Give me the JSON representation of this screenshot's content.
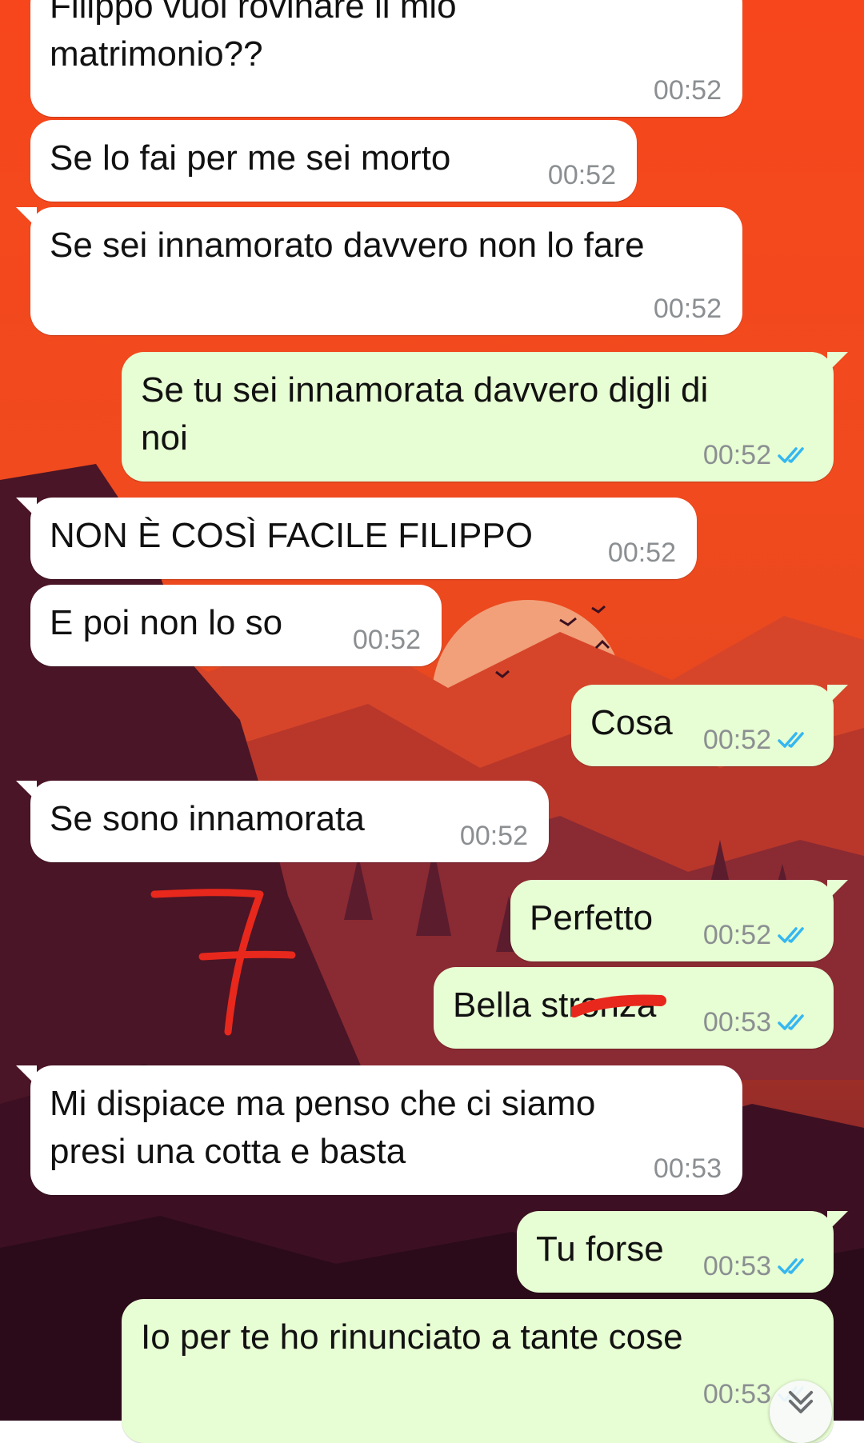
{
  "messages": [
    {
      "direction": "in",
      "text": "Filippo vuoi rovinare il mio\nmatrimonio??",
      "time": "00:52"
    },
    {
      "direction": "in",
      "text": "Se lo fai per me sei morto",
      "time": "00:52"
    },
    {
      "direction": "in",
      "text": "Se sei innamorato davvero non lo fare",
      "time": "00:52"
    },
    {
      "direction": "out",
      "text": "Se tu sei innamorata davvero digli di\nnoi",
      "time": "00:52",
      "status": "read"
    },
    {
      "direction": "in",
      "text": "NON È COSÌ FACILE FILIPPO",
      "time": "00:52"
    },
    {
      "direction": "in",
      "text": "E poi non lo so",
      "time": "00:52"
    },
    {
      "direction": "out",
      "text": "Cosa",
      "time": "00:52",
      "status": "read"
    },
    {
      "direction": "in",
      "text": "Se sono innamorata",
      "time": "00:52"
    },
    {
      "direction": "out",
      "text": "Perfetto",
      "time": "00:52",
      "status": "read"
    },
    {
      "direction": "out",
      "text": "Bella stronza",
      "time": "00:53",
      "status": "read"
    },
    {
      "direction": "in",
      "text": "Mi dispiace ma penso che ci siamo\npresi una cotta e basta",
      "time": "00:53"
    },
    {
      "direction": "out",
      "text": "Tu forse",
      "time": "00:53",
      "status": "read"
    },
    {
      "direction": "out",
      "text": "Io per te ho rinunciato a tante cose",
      "time": "00:53",
      "status": "read"
    }
  ],
  "annotation": {
    "text": "7",
    "color": "#e8281c"
  },
  "scroll_button": {
    "icon": "double-chevron-down-icon"
  },
  "colors": {
    "incoming_bubble": "#ffffff",
    "outgoing_bubble": "#e7fdd3",
    "time_text": "#8b8f92",
    "read_ticks": "#34b7f1"
  }
}
